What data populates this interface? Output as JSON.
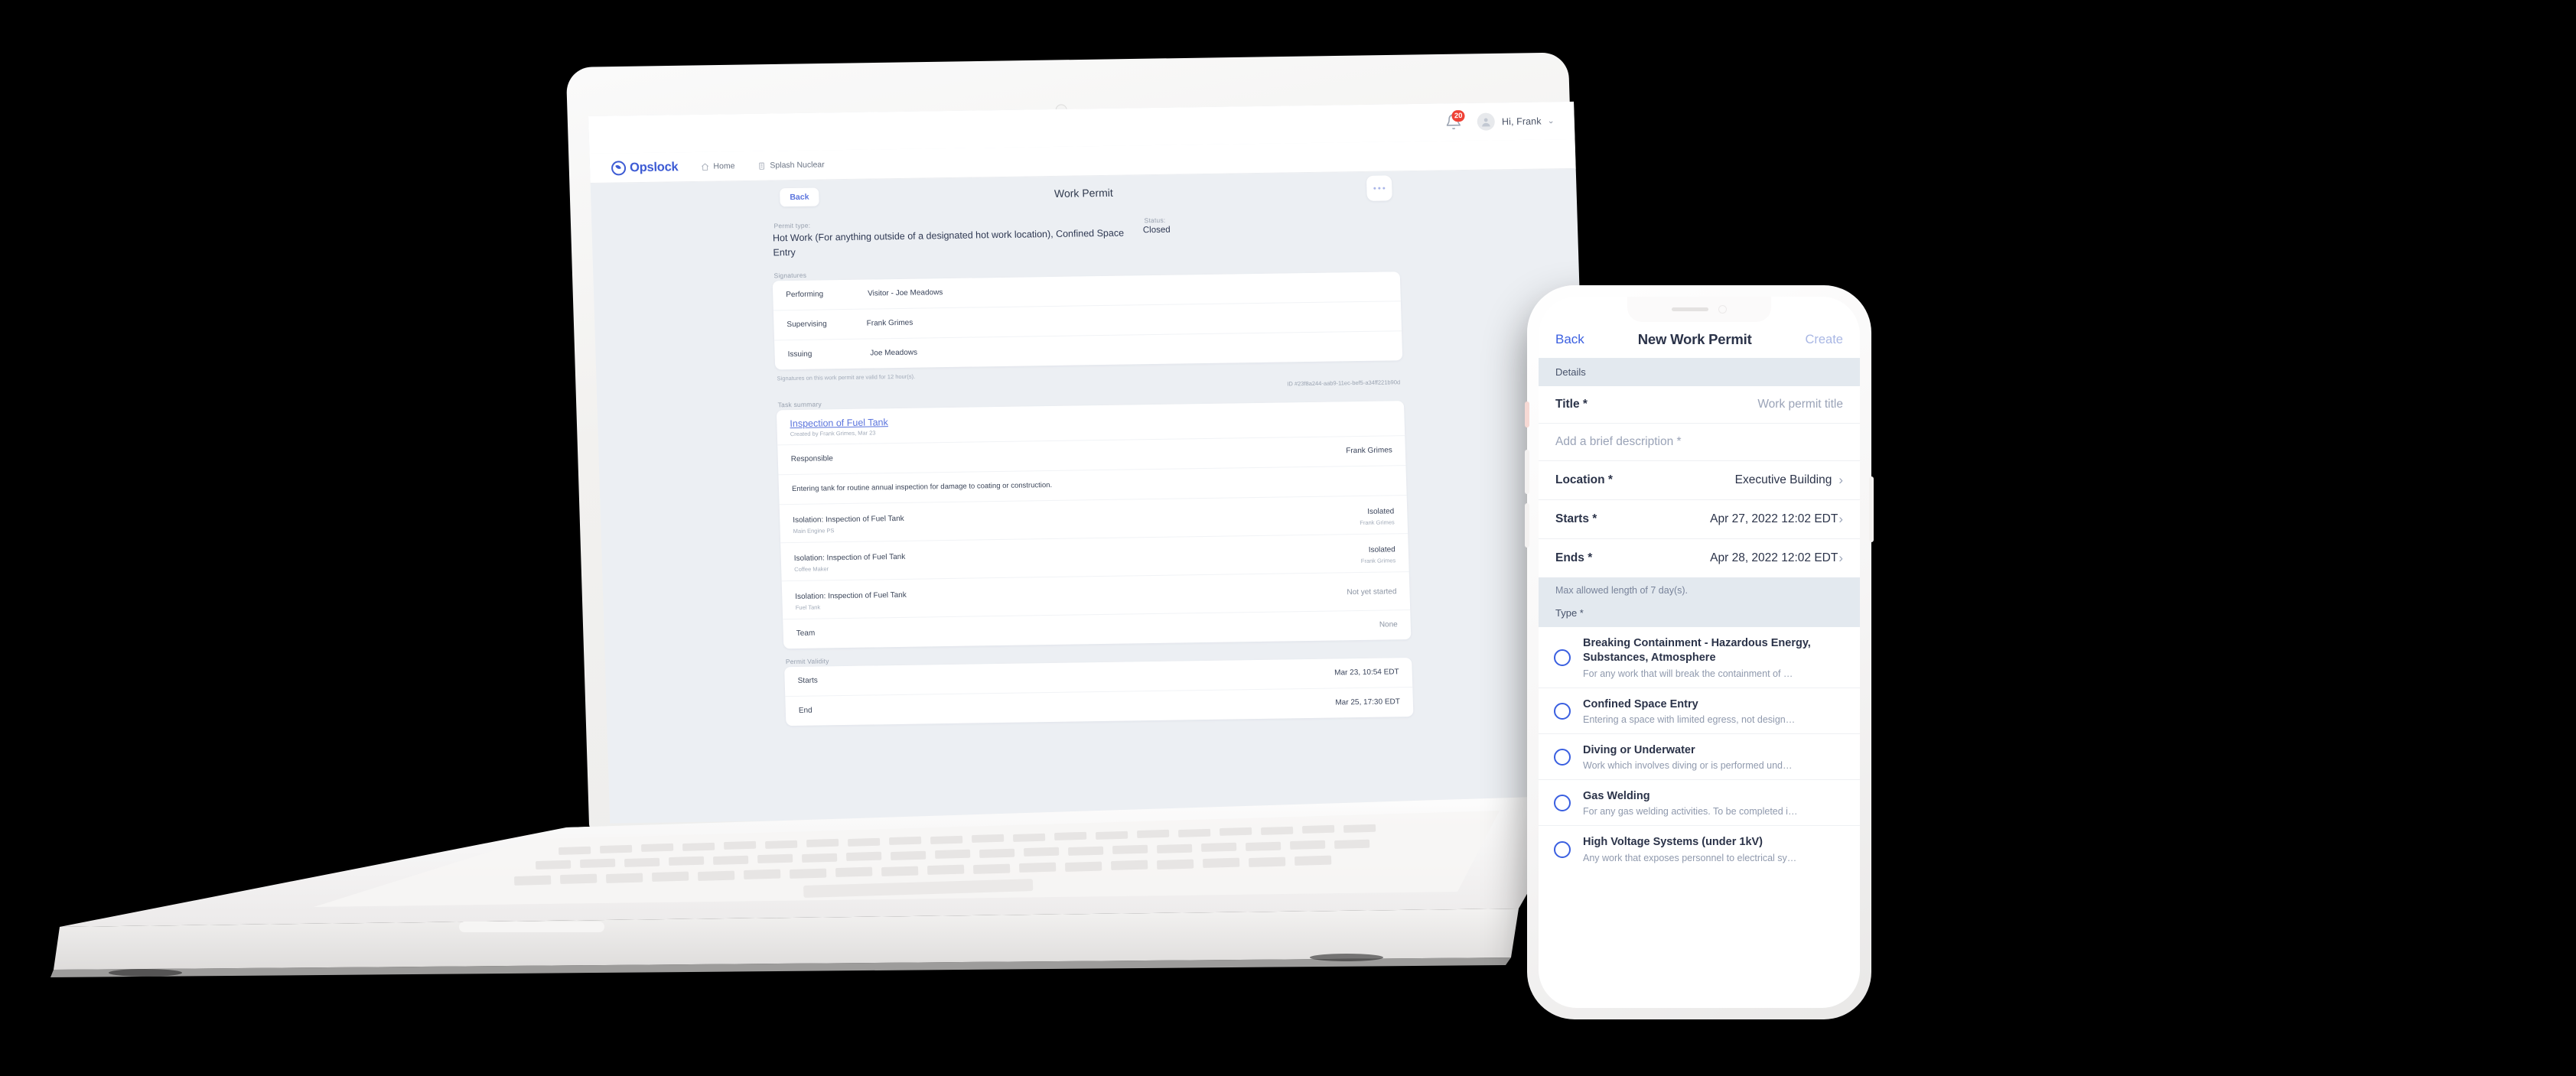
{
  "laptop": {
    "topbar": {
      "bell_icon": "bell-icon",
      "notification_count": "20",
      "avatar_icon": "avatar-icon",
      "greeting": "Hi, Frank",
      "chevron": "⌄"
    },
    "nav": {
      "brand": "Opslock",
      "items": [
        {
          "icon": "home-icon",
          "label": "Home"
        },
        {
          "icon": "building-icon",
          "label": "Splash Nuclear"
        }
      ]
    },
    "header": {
      "back_label": "Back",
      "page_title": "Work Permit",
      "overflow_label": "..."
    },
    "permit": {
      "type_label": "Permit type:",
      "type_value": "Hot Work (For anything outside of a designated hot work location), Confined Space Entry",
      "status_label": "Status:",
      "status_value": "Closed"
    },
    "signatures": {
      "section_label": "Signatures",
      "rows": [
        {
          "role": "Performing",
          "name": "Visitor - Joe Meadows"
        },
        {
          "role": "Supervising",
          "name": "Frank Grimes"
        },
        {
          "role": "Issuing",
          "name": "Joe Meadows"
        }
      ],
      "validity_note": "Signatures on this work permit are valid for 12 hour(s).",
      "permit_id": "ID #23f8a244-aab9-11ec-bef5-a34ff221b90d"
    },
    "task_summary": {
      "section_label": "Task summary",
      "task_title": "Inspection of Fuel Tank",
      "task_meta": "Created by Frank Grimes, Mar 23",
      "responsible_label": "Responsible",
      "responsible_value": "Frank Grimes",
      "description": "Entering tank for routine annual inspection for damage to coating or construction.",
      "isolations": [
        {
          "title": "Isolation: Inspection of Fuel Tank",
          "asset": "Main Engine PS",
          "status": "Isolated",
          "by": "Frank Grimes"
        },
        {
          "title": "Isolation: Inspection of Fuel Tank",
          "asset": "Coffee Maker",
          "status": "Isolated",
          "by": "Frank Grimes"
        },
        {
          "title": "Isolation: Inspection of Fuel Tank",
          "asset": "Fuel Tank",
          "status": "Not yet started",
          "by": ""
        }
      ],
      "team_label": "Team",
      "team_value": "None"
    },
    "validity": {
      "section_label": "Permit Validity",
      "rows": [
        {
          "label": "Starts",
          "value": "Mar 23, 10:54 EDT"
        },
        {
          "label": "End",
          "value": "Mar 25, 17:30 EDT"
        }
      ]
    }
  },
  "phone": {
    "header": {
      "back_label": "Back",
      "title": "New Work Permit",
      "create_label": "Create"
    },
    "details_section_label": "Details",
    "fields": [
      {
        "label": "Title *",
        "value": "Work permit title",
        "chevron": ""
      },
      {
        "label": "Add a brief description *",
        "value": "",
        "chevron": ""
      },
      {
        "label": "Location *",
        "value": "Executive Building",
        "chevron": "›"
      },
      {
        "label": "Starts *",
        "value": "Apr 27, 2022 12:02 EDT",
        "chevron": "›"
      },
      {
        "label": "Ends *",
        "value": "Apr 28, 2022 12:02 EDT",
        "chevron": "›"
      }
    ],
    "max_length_note": "Max allowed length of 7 day(s).",
    "type_section_label": "Type *",
    "type_options": [
      {
        "label": "Breaking Containment - Hazardous Energy, Substances, Atmosphere",
        "desc": "For any work that will break the containment of …",
        "selected": false
      },
      {
        "label": "Confined Space Entry",
        "desc": "Entering a space with limited egress, not design…",
        "selected": false
      },
      {
        "label": "Diving or Underwater",
        "desc": "Work which involves diving or is performed und…",
        "selected": false
      },
      {
        "label": "Gas Welding",
        "desc": "For any gas welding activities. To be completed i…",
        "selected": false
      },
      {
        "label": "High Voltage Systems (under 1kV)",
        "desc": "Any work that exposes personnel to electrical sy…",
        "selected": false
      }
    ]
  },
  "colors": {
    "page_bg": "#eceff3",
    "accent_blue": "#3d5bd4",
    "link_blue": "#5b74dd",
    "badge_red": "#ef4135",
    "text_dark": "#2e3852",
    "text_muted": "#97a0ae",
    "canvas": "#000000"
  }
}
